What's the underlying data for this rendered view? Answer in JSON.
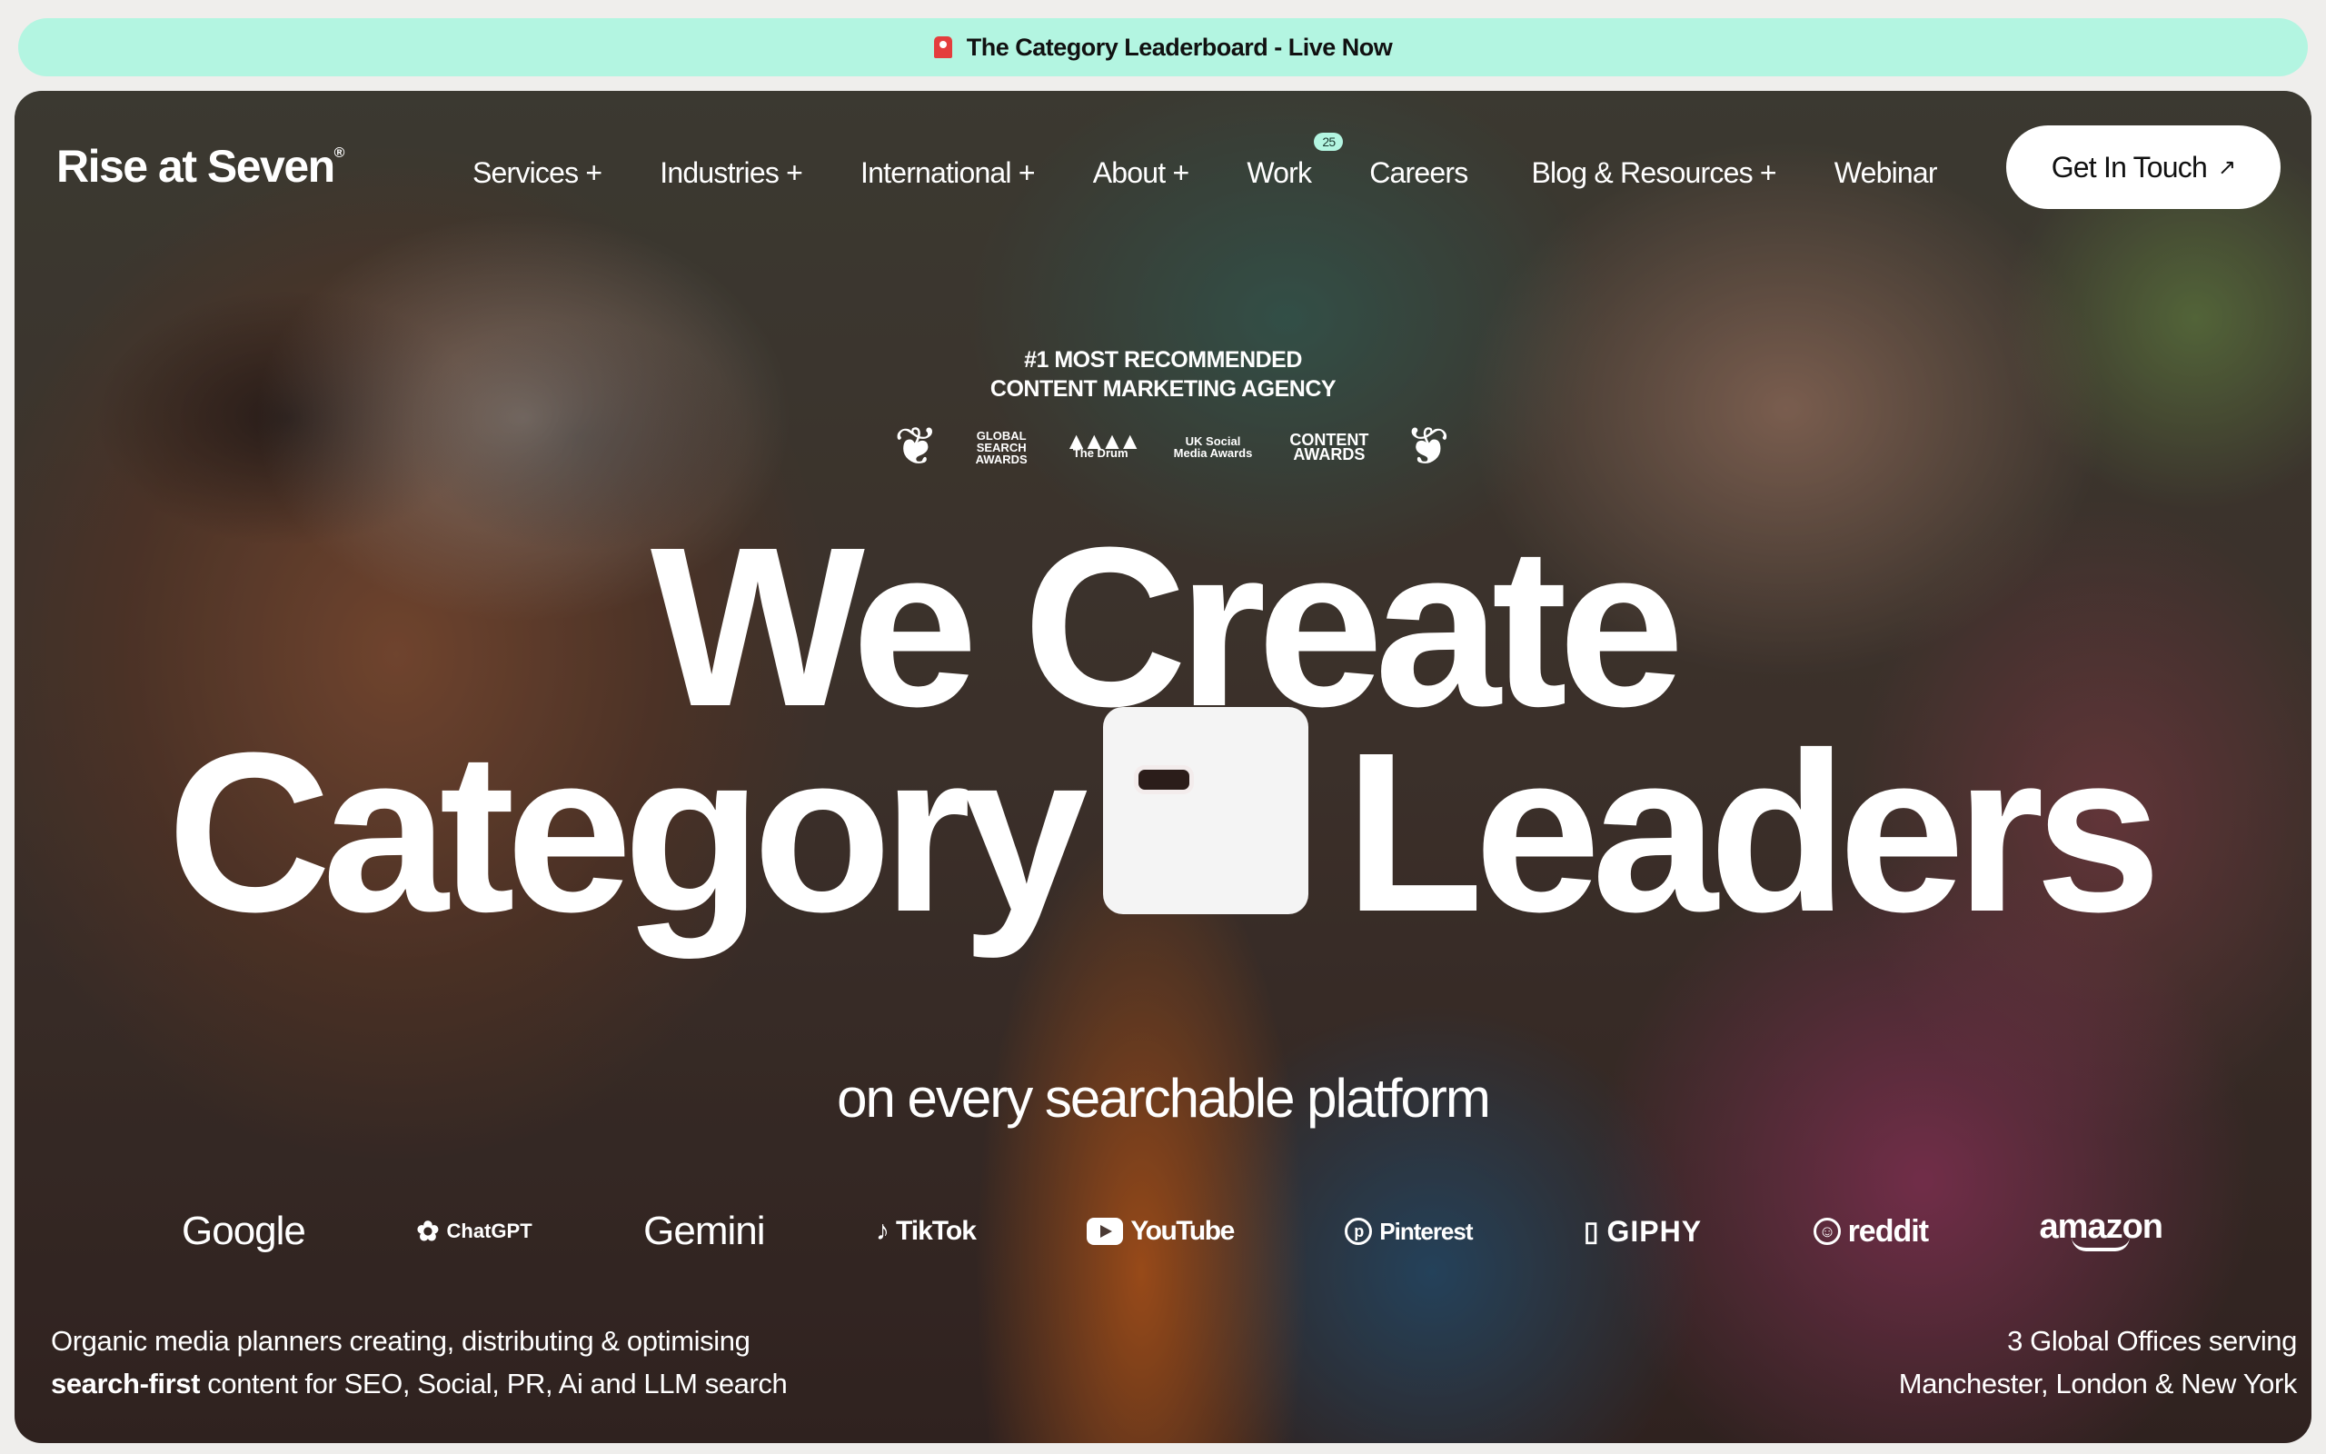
{
  "announcement": {
    "icon": "siren-icon",
    "text": "The Category Leaderboard - Live Now"
  },
  "brand": {
    "name": "Rise at Seven",
    "mark": "®"
  },
  "nav": {
    "items": [
      {
        "label": "Services +"
      },
      {
        "label": "Industries +"
      },
      {
        "label": "International +"
      },
      {
        "label": "About +"
      },
      {
        "label": "Work",
        "badge": "25"
      },
      {
        "label": "Careers"
      },
      {
        "label": "Blog & Resources +"
      },
      {
        "label": "Webinar"
      }
    ],
    "cta": {
      "label": "Get In Touch",
      "icon": "arrow-up-right-icon"
    }
  },
  "hero": {
    "tagline_line1": "#1 MOST RECOMMENDED",
    "tagline_line2": "CONTENT MARKETING AGENCY",
    "awards": [
      {
        "line1": "GLOBAL",
        "line2": "SEARCH",
        "line3": "AWARDS"
      },
      {
        "mark": "▲▲▲▲",
        "name": "The Drum"
      },
      {
        "line1": "UK Social",
        "line2": "Media Awards"
      },
      {
        "line1": "CONTENT",
        "line2": "AWARDS"
      }
    ],
    "headline_line1": "We Create",
    "headline_word1": "Category",
    "headline_word2": "Leaders",
    "subheadline": "on every searchable platform"
  },
  "platforms": [
    {
      "name": "Google"
    },
    {
      "name": "ChatGPT",
      "icon": "openai-icon"
    },
    {
      "name": "Gemini"
    },
    {
      "name": "TikTok",
      "icon": "tiktok-note-icon"
    },
    {
      "name": "YouTube",
      "icon": "youtube-play-icon"
    },
    {
      "name": "Pinterest",
      "icon": "pinterest-icon"
    },
    {
      "name": "GIPHY",
      "icon": "giphy-icon"
    },
    {
      "name": "reddit",
      "icon": "reddit-icon"
    },
    {
      "name": "amazon"
    }
  ],
  "footer": {
    "left_line1": "Organic media planners creating, distributing & optimising",
    "left_bold": "search-first",
    "left_line2_rest": " content for SEO, Social, PR, Ai and LLM search",
    "right_line1": "3 Global Offices serving",
    "right_line2": "Manchester, London & New York"
  },
  "colors": {
    "announce_bg": "#b3f5e1",
    "cta_bg": "#ffffff",
    "text": "#ffffff"
  }
}
